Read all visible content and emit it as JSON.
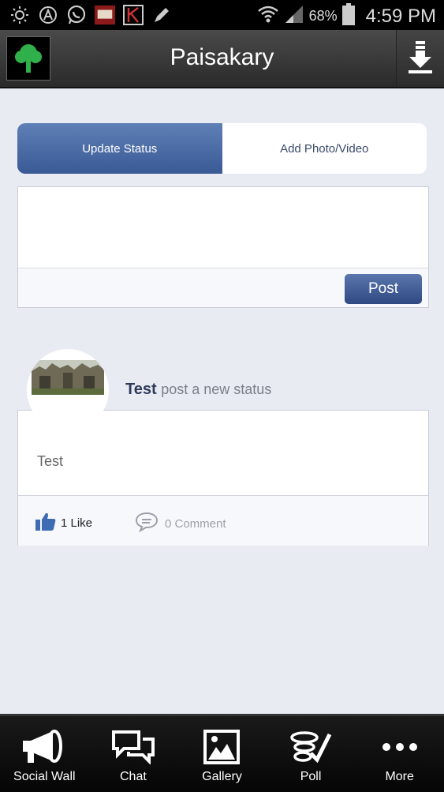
{
  "status_bar": {
    "battery": "68%",
    "time": "4:59 PM",
    "icons": [
      "brightness-icon",
      "app-a-icon",
      "whatsapp-icon",
      "app-logo-icon",
      "app-k-icon",
      "pencil-icon",
      "wifi-icon",
      "signal-icon",
      "battery-icon"
    ]
  },
  "app_bar": {
    "title": "Paisakary",
    "logo_icon": "tree-icon",
    "action_icon": "download-icon"
  },
  "tabs": [
    {
      "label": "Update Status",
      "active": true
    },
    {
      "label": "Add Photo/Video",
      "active": false
    }
  ],
  "composer": {
    "textarea_value": "",
    "post_label": "Post"
  },
  "feed": {
    "post": {
      "author": "Test",
      "action": "post a new status",
      "text": "Test",
      "likes": "1 Like",
      "comments": "0 Comment"
    }
  },
  "bottom_nav": [
    {
      "label": "Social Wall",
      "icon": "megaphone-icon"
    },
    {
      "label": "Chat",
      "icon": "chat-icon"
    },
    {
      "label": "Gallery",
      "icon": "gallery-icon"
    },
    {
      "label": "Poll",
      "icon": "poll-icon"
    },
    {
      "label": "More",
      "icon": "more-icon"
    }
  ],
  "colors": {
    "accent": "#3a5a96",
    "background": "#e9ebf3",
    "bar": "#2a2a2a"
  }
}
